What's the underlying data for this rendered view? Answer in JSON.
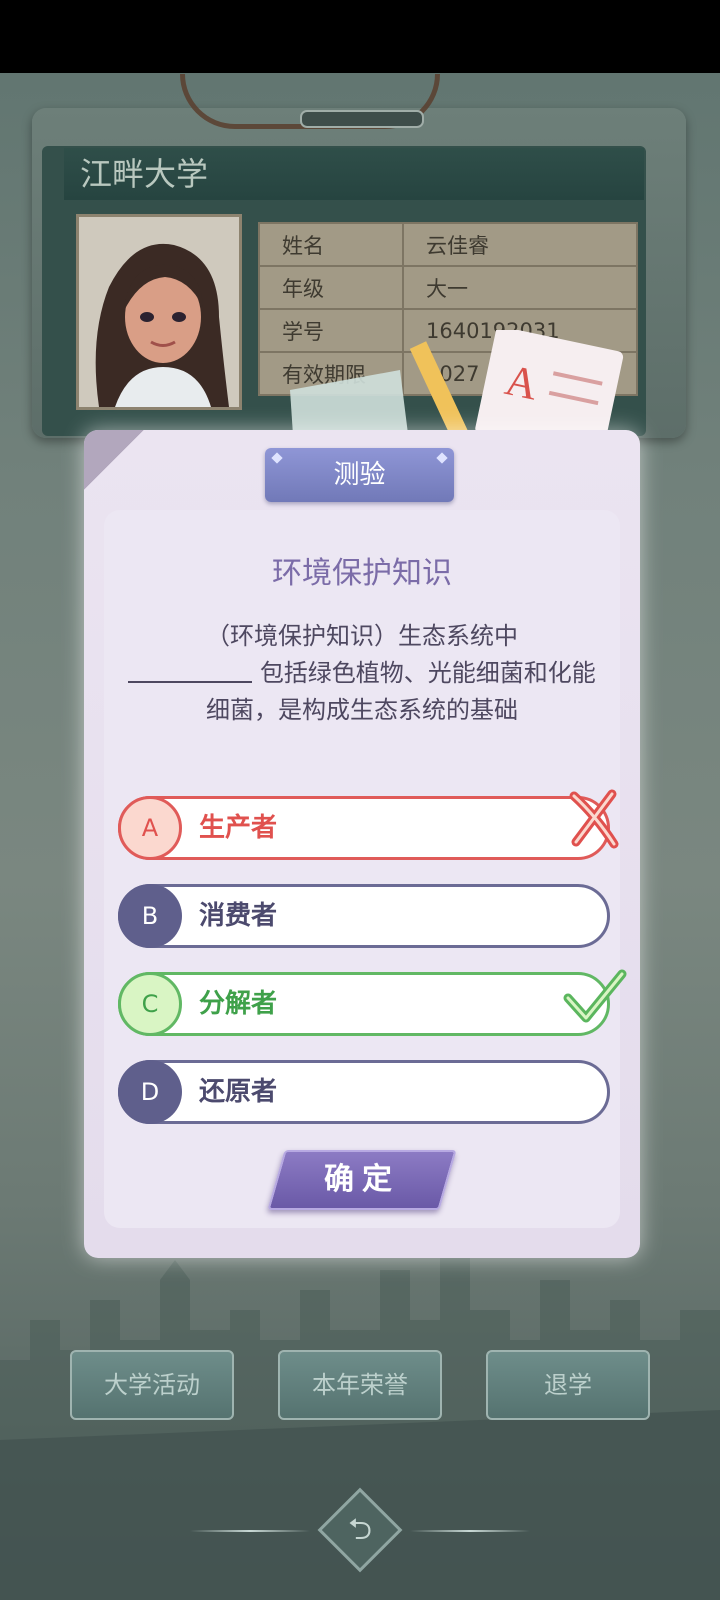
{
  "id_card": {
    "school": "江畔大学",
    "rows": [
      {
        "key": "姓名",
        "value": "云佳睿"
      },
      {
        "key": "年级",
        "value": "大一"
      },
      {
        "key": "学号",
        "value": "1640192031"
      },
      {
        "key": "有效期限",
        "value": "2027"
      }
    ]
  },
  "dialog": {
    "tab_label": "测验",
    "title": "环境保护知识",
    "question_part1": "（环境保护知识）生态系统中",
    "question_part2": "包括绿色植物、光能细菌和化能细菌，是构成生态系统的基础",
    "options": [
      {
        "letter": "A",
        "text": "生产者",
        "state": "wrong"
      },
      {
        "letter": "B",
        "text": "消费者",
        "state": "normal"
      },
      {
        "letter": "C",
        "text": "分解者",
        "state": "correct"
      },
      {
        "letter": "D",
        "text": "还原者",
        "state": "normal"
      }
    ],
    "confirm_label": "确定"
  },
  "bottom_menu": {
    "activities": "大学活动",
    "honors": "本年荣誉",
    "dropout": "退学",
    "back_icon": "back-arrow-icon"
  },
  "colors": {
    "accent": "#7b6ca8",
    "wrong": "#e0514e",
    "correct": "#3fa14a"
  }
}
